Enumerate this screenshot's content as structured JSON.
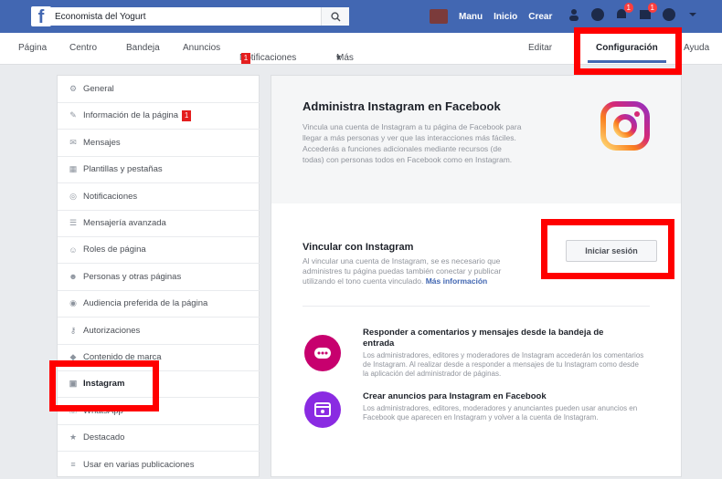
{
  "header": {
    "logo": "f",
    "search": {
      "value": "Economista del Yogurt",
      "icon": "search-icon"
    },
    "nav": [
      "Manu",
      "Inicio",
      "Crear"
    ],
    "notification_counts": [
      "1",
      "1"
    ]
  },
  "subnav": {
    "tabs": [
      "Página",
      "Centro",
      "Bandeja",
      "Anuncios",
      "Notificaciones",
      "Más"
    ],
    "notif_badge": "1",
    "more_suffix": "▾",
    "right_items": [
      "Editar",
      "Configuración",
      "Ayuda"
    ],
    "active_tab": "Configuración"
  },
  "sidebar": {
    "items": [
      {
        "label": "General",
        "icon": "gear-icon"
      },
      {
        "label": "Información de la página",
        "icon": "pencil-icon",
        "badge": "1"
      },
      {
        "label": "Mensajes",
        "icon": "message-icon"
      },
      {
        "label": "Plantillas y pestañas",
        "icon": "grid-icon"
      },
      {
        "label": "Notificaciones",
        "icon": "globe-icon"
      },
      {
        "label": "Mensajería avanzada",
        "icon": "chat-icon"
      },
      {
        "label": "Roles de página",
        "icon": "person-icon"
      },
      {
        "label": "Personas y otras páginas",
        "icon": "people-icon"
      },
      {
        "label": "Audiencia preferida de la página",
        "icon": "audience-icon"
      },
      {
        "label": "Autorizaciones",
        "icon": "key-icon"
      },
      {
        "label": "Contenido de marca",
        "icon": "tag-icon"
      },
      {
        "label": "Instagram",
        "icon": "instagram-icon"
      },
      {
        "label": "WhatsApp",
        "icon": "phone-icon"
      },
      {
        "label": "Destacado",
        "icon": "star-icon"
      },
      {
        "label": "Usar en varias publicaciones",
        "icon": "list-icon"
      }
    ]
  },
  "main": {
    "title": "Administra Instagram en Facebook",
    "description": "Vincula una cuenta de Instagram a tu página de Facebook para llegar a más personas y ver que las interacciones más fáciles. Accederás a funciones adicionales mediante recursos (de todas) con personas todos en Facebook como en Instagram.",
    "connect_title": "Vincular con Instagram",
    "connect_desc": "Al vincular una cuenta de Instagram, se es necesario que administres tu página puedas también conectar y publicar utilizando el tono cuenta vinculado.",
    "connect_link": "Más información",
    "start_button": "Iniciar sesión",
    "features": [
      {
        "title": "Responder a comentarios y mensajes desde la bandeja de entrada",
        "desc": "Los administradores, editores y moderadores de Instagram accederán los comentarios de Instagram. Al realizar desde a responder a mensajes de tu Instagram como desde la aplicación del administrador de páginas."
      },
      {
        "title": "Crear anuncios para Instagram en Facebook",
        "desc": "Los administradores, editores, moderadores y anunciantes pueden usar anuncios en Facebook que aparecen en Instagram y volver a la cuenta de Instagram."
      }
    ]
  },
  "colors": {
    "brand": "#4267b2",
    "highlight": "#ff0000"
  }
}
